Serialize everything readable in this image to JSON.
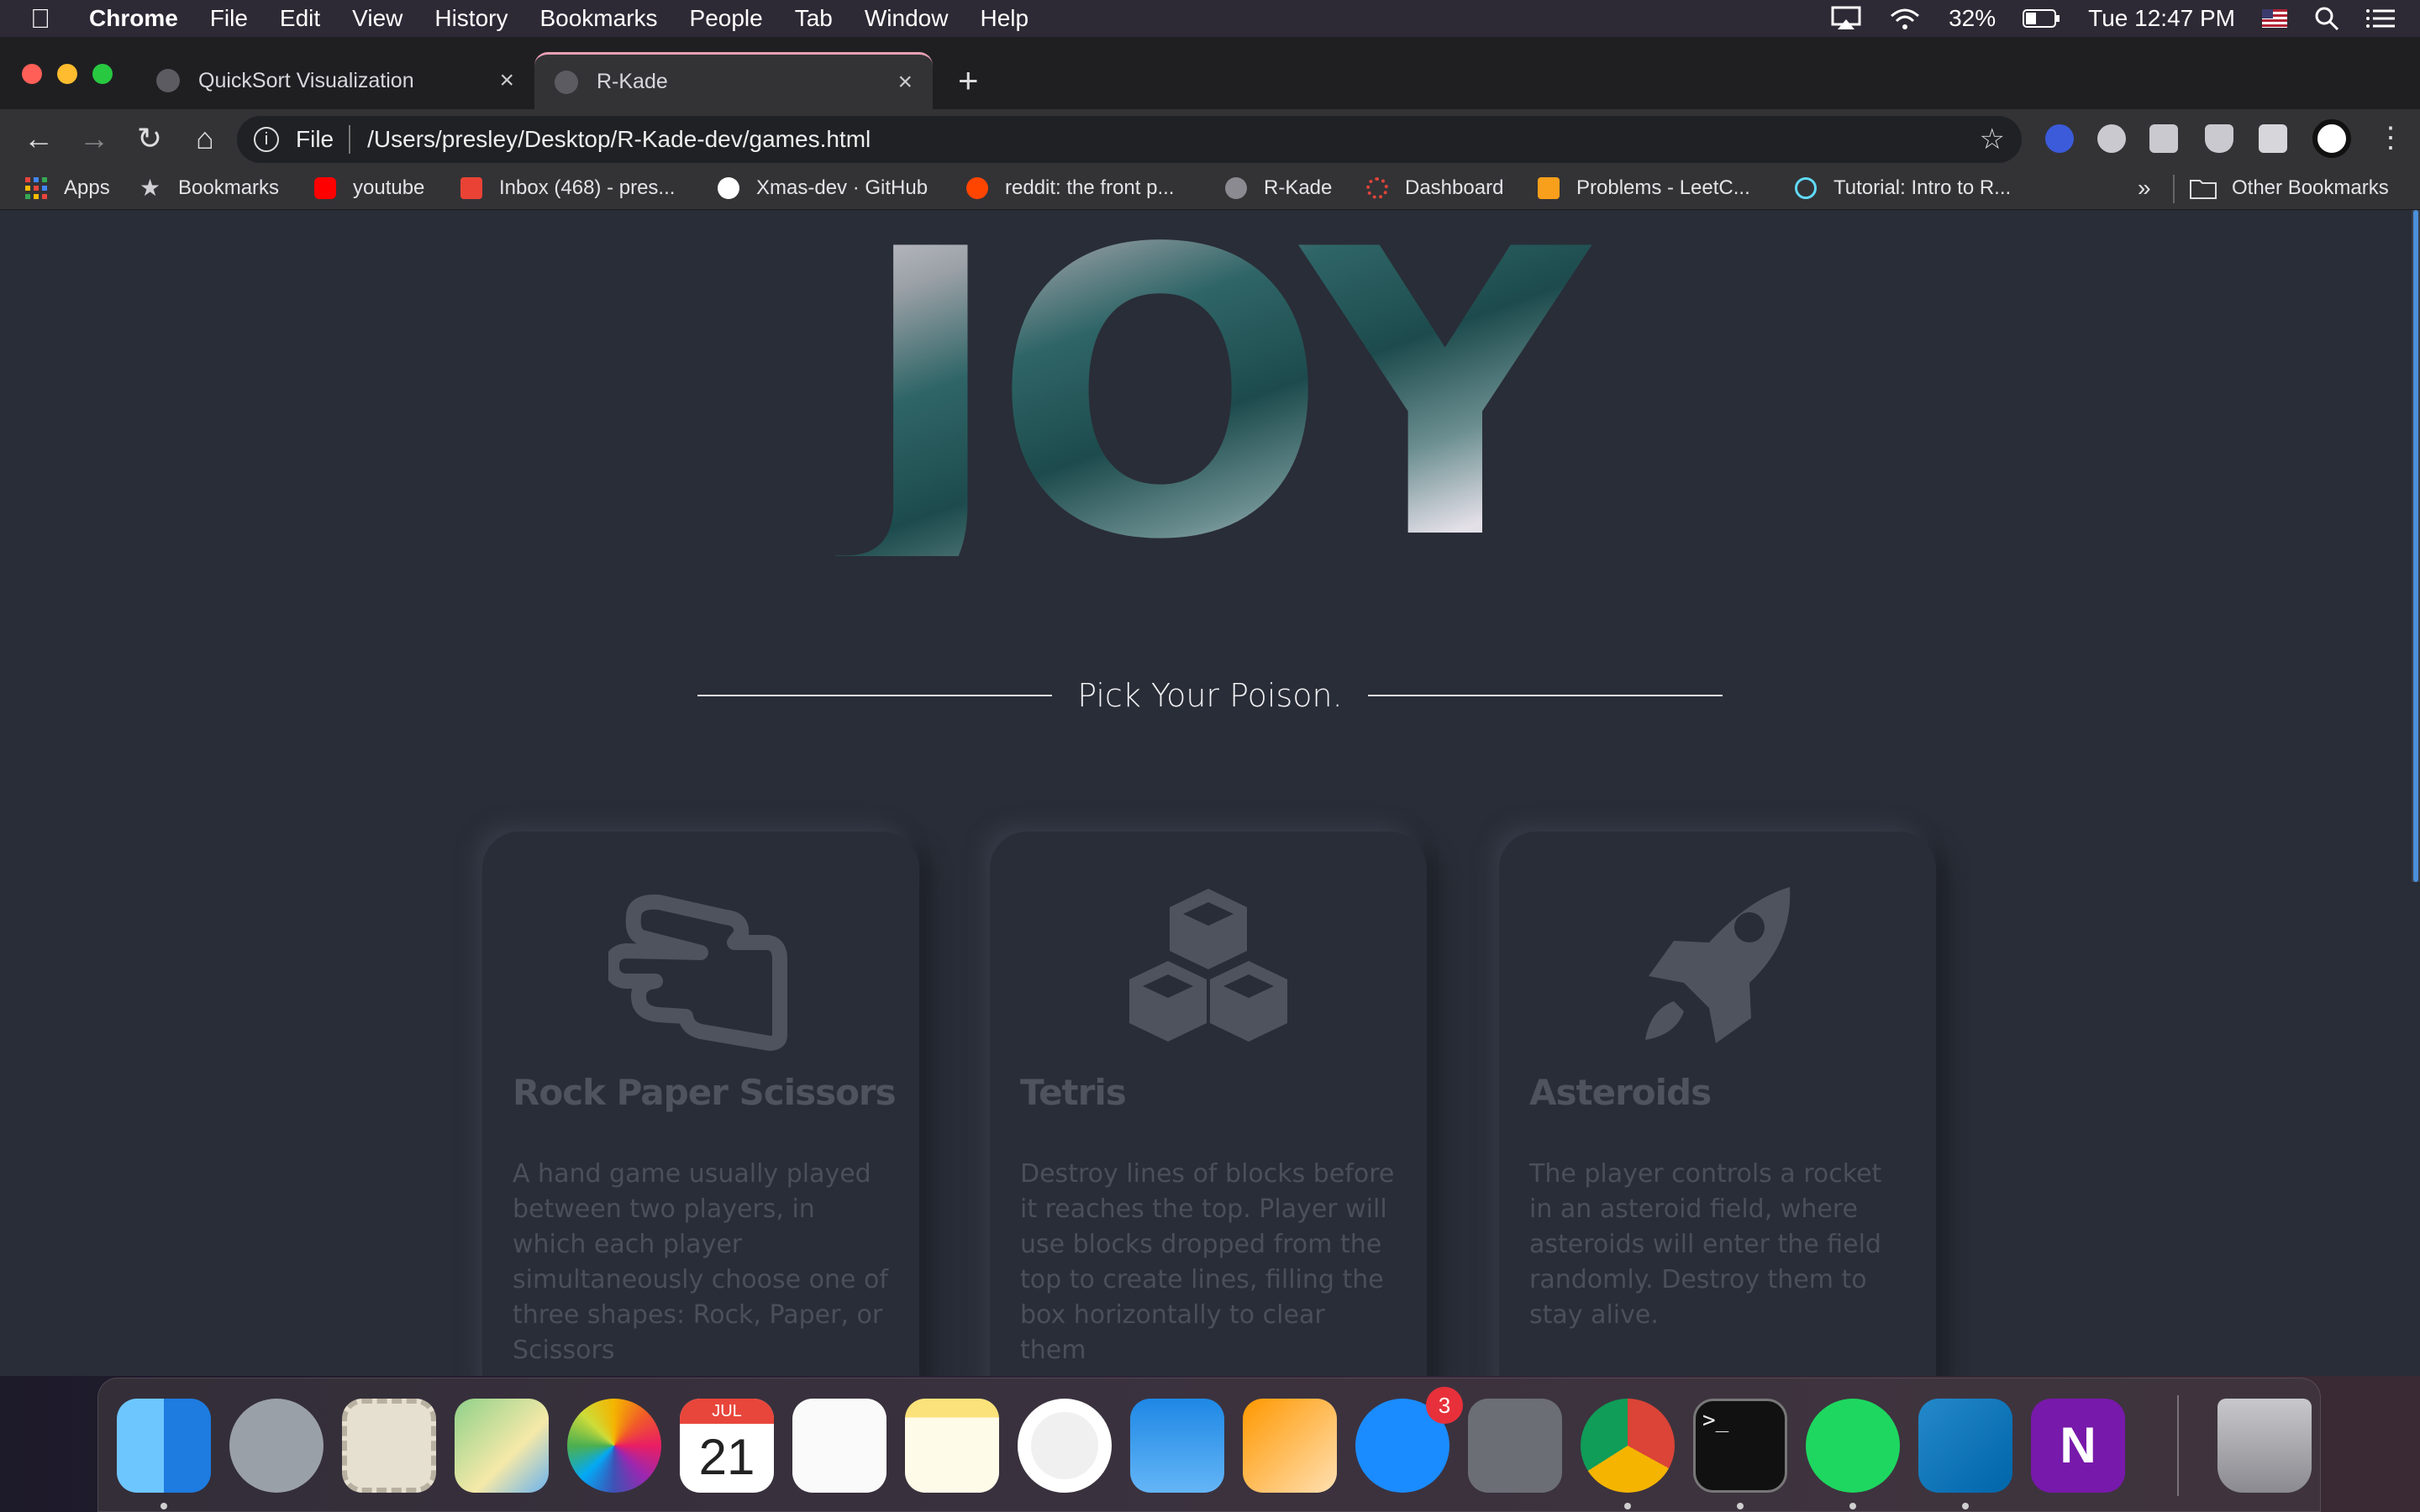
{
  "menubar": {
    "app": "Chrome",
    "items": [
      "File",
      "Edit",
      "View",
      "History",
      "Bookmarks",
      "People",
      "Tab",
      "Window",
      "Help"
    ],
    "battery": "32%",
    "clock": "Tue 12:47 PM"
  },
  "tabs": [
    {
      "title": "QuickSort Visualization",
      "close": "×"
    },
    {
      "title": "R-Kade",
      "close": "×"
    }
  ],
  "newtab": "+",
  "toolbar": {
    "back": "←",
    "forward": "→",
    "reload": "↻",
    "home": "⌂",
    "scheme": "File",
    "url": "/Users/presley/Desktop/R-Kade-dev/games.html",
    "star": "☆",
    "menu": "⋮"
  },
  "bookmarks": [
    {
      "label": "Apps",
      "color": "#e8453c"
    },
    {
      "label": "Bookmarks",
      "color": "#d0d0d4"
    },
    {
      "label": "youtube",
      "color": "#ff0000"
    },
    {
      "label": "Inbox (468) - pres...",
      "color": "#ea4335"
    },
    {
      "label": "Xmas-dev · GitHub",
      "color": "#ffffff"
    },
    {
      "label": "reddit: the front p...",
      "color": "#ff4500"
    },
    {
      "label": "R-Kade",
      "color": "#8a8a90"
    },
    {
      "label": "Dashboard",
      "color": "#e0443a"
    },
    {
      "label": "Problems - LeetC...",
      "color": "#f89f1b"
    },
    {
      "label": "Tutorial: Intro to R...",
      "color": "#61dafb"
    }
  ],
  "bookmarks_more": "»",
  "other_bookmarks": "Other Bookmarks",
  "hero": {
    "word": "JOY",
    "tagline": "Pick Your Poison."
  },
  "games": [
    {
      "icon": "hand-scissors-icon",
      "title": "Rock Paper Scissors",
      "description": "A hand game usually played between two players, in which each player simultaneously choose one of three shapes: Rock, Paper, or Scissors"
    },
    {
      "icon": "cubes-icon",
      "title": "Tetris",
      "description": "Destroy lines of blocks before it reaches the top. Player will use blocks dropped from the top to create lines, filling the box horizontally to clear them"
    },
    {
      "icon": "rocket-icon",
      "title": "Asteroids",
      "description": "The player controls a rocket in an asteroid field, where asteroids will enter the field randomly. Destroy them to stay alive."
    }
  ],
  "dock": {
    "calendar_month": "JUL",
    "calendar_day": "21",
    "appstore_badge": "3",
    "terminal_prompt": ">_",
    "onenote_letter": "N"
  }
}
